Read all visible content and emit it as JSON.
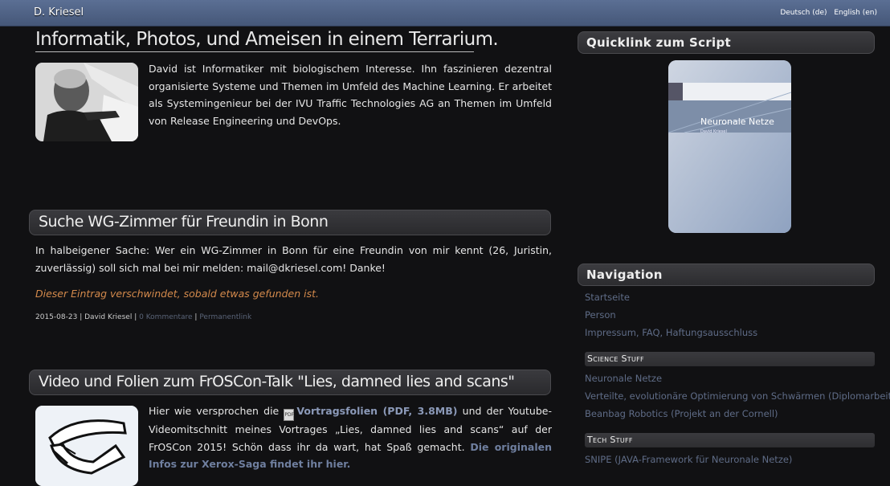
{
  "header": {
    "site_title": "D. Kriesel",
    "lang_de": "Deutsch (de)",
    "lang_en": "English (en)"
  },
  "intro": {
    "title": "Informatik, Photos, und Ameisen in einem Terrarium.",
    "text": "David ist Informatiker mit biologischem Interesse. Ihn faszinieren dezentral organisierte Systeme und Themen im Umfeld des Machine Learning. Er arbeitet als Systemingenieur bei der IVU Traffic Technologies AG an Themen im Umfeld von Release Engineering und DevOps."
  },
  "post1": {
    "title": "Suche WG-Zimmer für Freundin in Bonn",
    "text": "In halbeigener Sache: Wer ein WG-Zimmer in Bonn für eine Freundin von mir kennt (26, Juristin, zuverlässig) soll sich mal bei mir melden: mail@dkriesel.com! Danke!",
    "note": "Dieser Eintrag verschwindet, sobald etwas gefunden ist.",
    "date": "2015-08-23",
    "author": "David Kriesel",
    "comments": "0 Kommentare",
    "permalink": "Permanentlink",
    "sep": "|"
  },
  "post2": {
    "title": "Video und Folien zum FrOSCon-Talk \"Lies, damned lies and scans\"",
    "text_a": "Hier wie versprochen die",
    "slides_link": "Vortragsfolien (PDF, 3.8MB)",
    "text_b": "und der Youtube-Videomitschnitt meines Vortrages „Lies, damned lies and scans“ auf der FrOSCon 2015! Schön dass ihr da wart, hat Spaß gemacht.",
    "xerox_link": "Die originalen Infos zur Xerox-Saga findet ihr hier."
  },
  "sidebar": {
    "quicklink_title": "Quicklink zum Script",
    "book_title": "Neuronale Netze",
    "book_author": "David Kriesel",
    "nav_title": "Navigation",
    "nav_items": [
      "Startseite",
      "Person",
      "Impressum, FAQ, Haftungsausschluss"
    ],
    "science_title": "Science Stuff",
    "science_items": [
      "Neuronale Netze",
      "Verteilte, evolutionäre Optimierung von Schwärmen (Diplomarbeit)",
      "Beanbag Robotics (Projekt an der Cornell)"
    ],
    "tech_title": "Tech Stuff",
    "tech_items": [
      "SNIPE (JAVA-Framework für Neuronale Netze)"
    ]
  },
  "colors": {
    "topbar": "#4f6286",
    "background": "#111113",
    "link": "#5f6c87",
    "note": "#d48a4c"
  }
}
